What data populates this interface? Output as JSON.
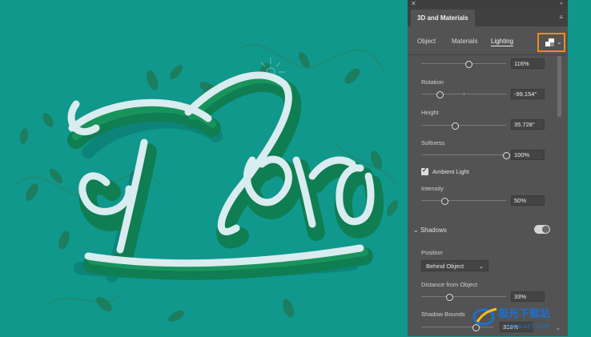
{
  "artwork": {
    "text": "Flora",
    "colors": {
      "background": "#10988d",
      "letter": "#d9ecef",
      "extrude": "#0f7e52",
      "leaf": "#1f7a56"
    }
  },
  "panel": {
    "title": "3D and Materials",
    "tabs": [
      "Object",
      "Materials",
      "Lighting"
    ],
    "active_tab": "Lighting",
    "preset_value": "116%",
    "preset_level": 0.56,
    "rotation": {
      "label": "Rotation",
      "value": "-99.154°",
      "level": 0.22
    },
    "height": {
      "label": "Height",
      "value": "35.728°",
      "level": 0.4
    },
    "softness": {
      "label": "Softness",
      "value": "100%",
      "level": 1.0
    },
    "ambient": {
      "label": "Ambient Light",
      "checked": true
    },
    "intensity": {
      "label": "Intensity",
      "value": "50%",
      "level": 0.27
    },
    "shadows": {
      "label": "Shadows",
      "enabled": true
    },
    "position": {
      "label": "Position",
      "value": "Behind Object"
    },
    "distance": {
      "label": "Distance from Object",
      "value": "33%",
      "level": 0.33
    },
    "shadow_bounds": {
      "label": "Shadow Bounds",
      "value": "318%",
      "level": 0.75
    },
    "accent": "#f08a1d"
  },
  "watermark": {
    "text": "极光下载站",
    "url": "www.xz7.com"
  }
}
